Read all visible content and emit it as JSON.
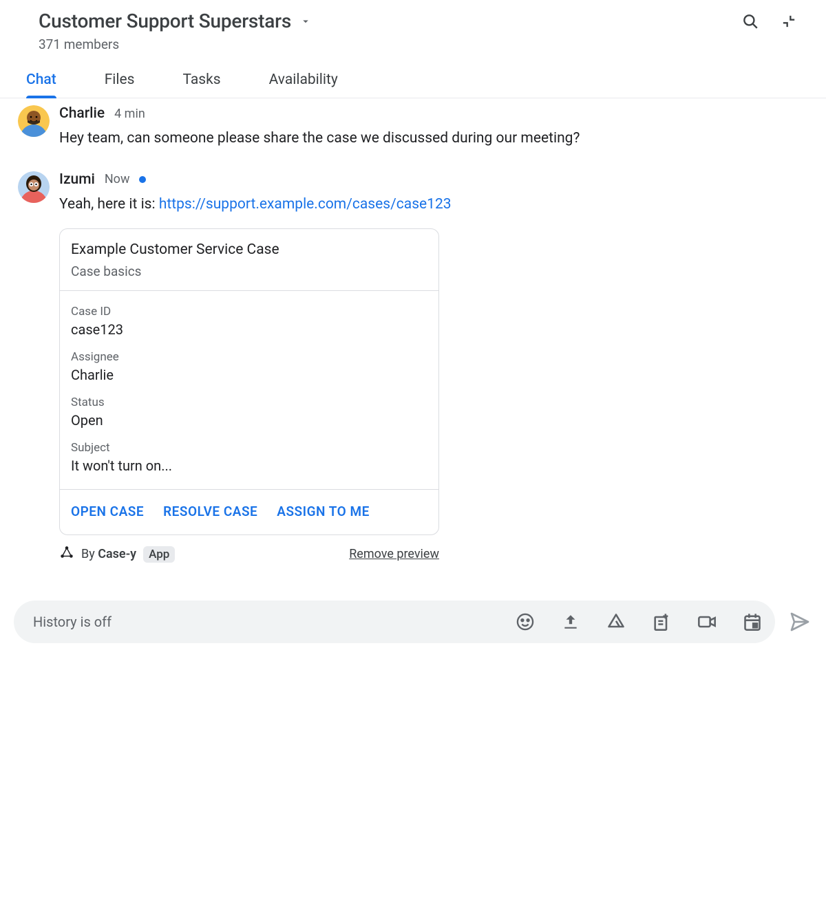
{
  "header": {
    "title": "Customer Support Superstars",
    "member_count": "371 members"
  },
  "tabs": [
    {
      "label": "Chat",
      "active": true
    },
    {
      "label": "Files",
      "active": false
    },
    {
      "label": "Tasks",
      "active": false
    },
    {
      "label": "Availability",
      "active": false
    }
  ],
  "messages": [
    {
      "sender": "Charlie",
      "time": "4 min",
      "text": "Hey team, can someone please share the case we discussed during our meeting?"
    },
    {
      "sender": "Izumi",
      "time": "Now",
      "unread": true,
      "text_prefix": "Yeah, here it is: ",
      "link_text": "https://support.example.com/cases/case123"
    }
  ],
  "card": {
    "title": "Example Customer Service Case",
    "subtitle": "Case basics",
    "fields": [
      {
        "label": "Case ID",
        "value": "case123"
      },
      {
        "label": "Assignee",
        "value": "Charlie"
      },
      {
        "label": "Status",
        "value": "Open"
      },
      {
        "label": "Subject",
        "value": "It won't turn on..."
      }
    ],
    "actions": [
      {
        "label": "OPEN CASE"
      },
      {
        "label": "RESOLVE CASE"
      },
      {
        "label": "ASSIGN TO ME"
      }
    ],
    "by_prefix": "By ",
    "by_name": "Case-y",
    "app_badge": "App",
    "remove_preview": "Remove preview"
  },
  "compose": {
    "placeholder": "History is off"
  }
}
